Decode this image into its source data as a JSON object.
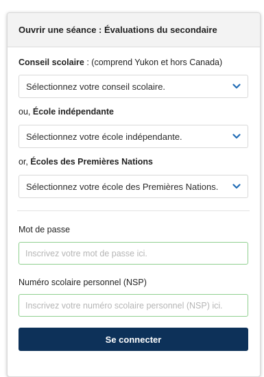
{
  "panel": {
    "title": "Ouvrir une séance : Évaluations du secondaire"
  },
  "school_board": {
    "label_bold": "Conseil scolaire",
    "label_rest": " : (comprend Yukon et hors Canada)",
    "selected": "Sélectionnez votre conseil scolaire."
  },
  "independent_school": {
    "label_prefix": "ou, ",
    "label_bold": "École indépendante",
    "selected": "Sélectionnez votre école indépendante."
  },
  "first_nations_school": {
    "label_prefix": "or, ",
    "label_bold": "Écoles des Premières Nations",
    "selected": "Sélectionnez votre école des Premières Nations."
  },
  "password": {
    "label": "Mot de passe",
    "placeholder": "Inscrivez votre mot de passe ici.",
    "value": ""
  },
  "pen": {
    "label": "Numéro scolaire personnel (NSP)",
    "placeholder": "Inscrivez votre numéro scolaire personnel (NSP) ici.",
    "value": ""
  },
  "submit": {
    "label": "Se connecter"
  },
  "colors": {
    "accent": "#0d3159",
    "chevron": "#1f6bb5",
    "input_border": "#8fcf8f"
  },
  "icons": {
    "select_chevron": "chevron-down-icon"
  }
}
